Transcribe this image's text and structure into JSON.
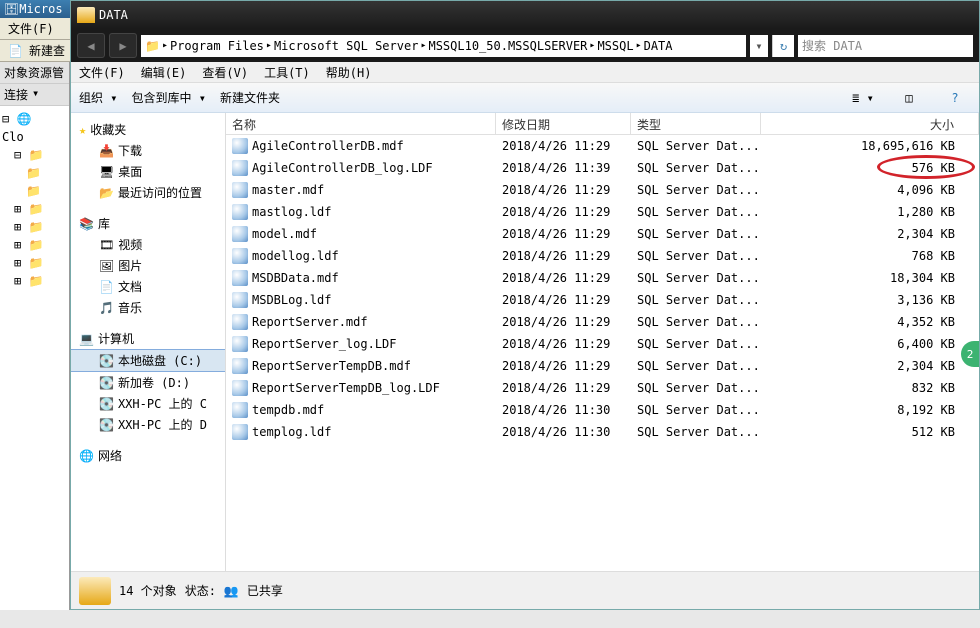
{
  "outerApp": {
    "title": "Micros",
    "menus": [
      "文件(F)"
    ],
    "toolbarNew": "新建查",
    "sidebarTitle": "对象资源管",
    "connect": "连接",
    "treeRoot": "Clo"
  },
  "explorer": {
    "title": "DATA",
    "path": [
      "Program Files",
      "Microsoft SQL Server",
      "MSSQL10_50.MSSQLSERVER",
      "MSSQL",
      "DATA"
    ],
    "searchPlaceholder": "搜索 DATA",
    "menus": [
      {
        "label": "文件(F)"
      },
      {
        "label": "编辑(E)"
      },
      {
        "label": "查看(V)"
      },
      {
        "label": "工具(T)"
      },
      {
        "label": "帮助(H)"
      }
    ],
    "toolbar": {
      "organize": "组织",
      "includeLib": "包含到库中",
      "newFolder": "新建文件夹"
    },
    "nav": {
      "favorites": {
        "label": "收藏夹",
        "items": [
          "下载",
          "桌面",
          "最近访问的位置"
        ]
      },
      "library": {
        "label": "库",
        "items": [
          "视频",
          "图片",
          "文档",
          "音乐"
        ]
      },
      "computer": {
        "label": "计算机",
        "items": [
          "本地磁盘 (C:)",
          "新加卷 (D:)",
          "XXH-PC 上的 C",
          "XXH-PC 上的 D"
        ],
        "selectedIndex": 0
      },
      "network": {
        "label": "网络"
      }
    },
    "columns": {
      "name": "名称",
      "date": "修改日期",
      "type": "类型",
      "size": "大小"
    },
    "files": [
      {
        "name": "AgileControllerDB.mdf",
        "date": "2018/4/26 11:29",
        "type": "SQL Server Dat...",
        "size": "18,695,616 KB"
      },
      {
        "name": "AgileControllerDB_log.LDF",
        "date": "2018/4/26 11:39",
        "type": "SQL Server Dat...",
        "size": "576 KB",
        "highlight": true
      },
      {
        "name": "master.mdf",
        "date": "2018/4/26 11:29",
        "type": "SQL Server Dat...",
        "size": "4,096 KB"
      },
      {
        "name": "mastlog.ldf",
        "date": "2018/4/26 11:29",
        "type": "SQL Server Dat...",
        "size": "1,280 KB"
      },
      {
        "name": "model.mdf",
        "date": "2018/4/26 11:29",
        "type": "SQL Server Dat...",
        "size": "2,304 KB"
      },
      {
        "name": "modellog.ldf",
        "date": "2018/4/26 11:29",
        "type": "SQL Server Dat...",
        "size": "768 KB"
      },
      {
        "name": "MSDBData.mdf",
        "date": "2018/4/26 11:29",
        "type": "SQL Server Dat...",
        "size": "18,304 KB"
      },
      {
        "name": "MSDBLog.ldf",
        "date": "2018/4/26 11:29",
        "type": "SQL Server Dat...",
        "size": "3,136 KB"
      },
      {
        "name": "ReportServer.mdf",
        "date": "2018/4/26 11:29",
        "type": "SQL Server Dat...",
        "size": "4,352 KB"
      },
      {
        "name": "ReportServer_log.LDF",
        "date": "2018/4/26 11:29",
        "type": "SQL Server Dat...",
        "size": "6,400 KB"
      },
      {
        "name": "ReportServerTempDB.mdf",
        "date": "2018/4/26 11:29",
        "type": "SQL Server Dat...",
        "size": "2,304 KB"
      },
      {
        "name": "ReportServerTempDB_log.LDF",
        "date": "2018/4/26 11:29",
        "type": "SQL Server Dat...",
        "size": "832 KB"
      },
      {
        "name": "tempdb.mdf",
        "date": "2018/4/26 11:30",
        "type": "SQL Server Dat...",
        "size": "8,192 KB"
      },
      {
        "name": "templog.ldf",
        "date": "2018/4/26 11:30",
        "type": "SQL Server Dat...",
        "size": "512 KB"
      }
    ],
    "status": {
      "count": "14 个对象",
      "state": "状态:",
      "shared": "已共享"
    },
    "badge": "2"
  }
}
